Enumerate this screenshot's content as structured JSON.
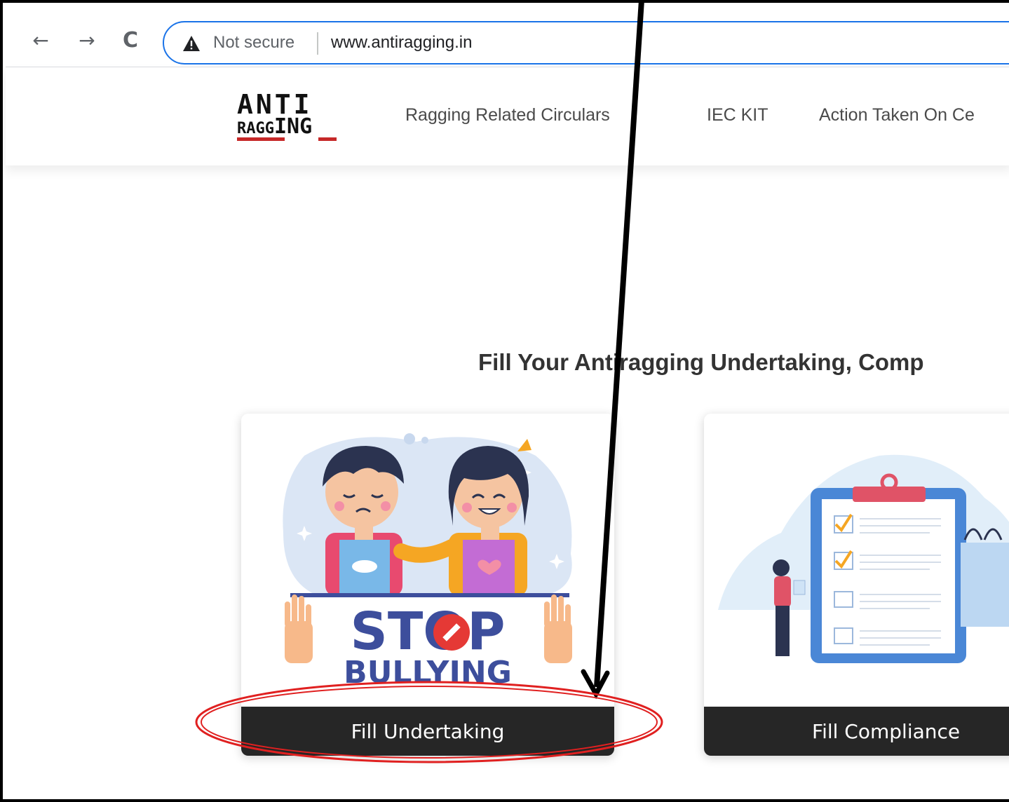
{
  "browser": {
    "security_label": "Not secure",
    "url": "www.antiragging.in"
  },
  "site": {
    "logo_top": "ANTI",
    "logo_bottom_left": "RAGG",
    "logo_bottom_right": "ING",
    "nav": [
      "Ragging Related Circulars",
      "IEC KIT",
      "Action Taken On Ce"
    ]
  },
  "main": {
    "heading": "Fill Your Antiragging Undertaking, Comp",
    "cards": [
      {
        "button": "Fill Undertaking",
        "poster_line1": "STOP",
        "poster_line2": "BULLYING"
      },
      {
        "button": "Fill Compliance"
      }
    ]
  },
  "colors": {
    "omnibox_border": "#1a73e8",
    "button_bg": "#262626",
    "annotation_red": "#e02020",
    "poster_blue": "#3d4e9c",
    "poster_red": "#e53935"
  }
}
